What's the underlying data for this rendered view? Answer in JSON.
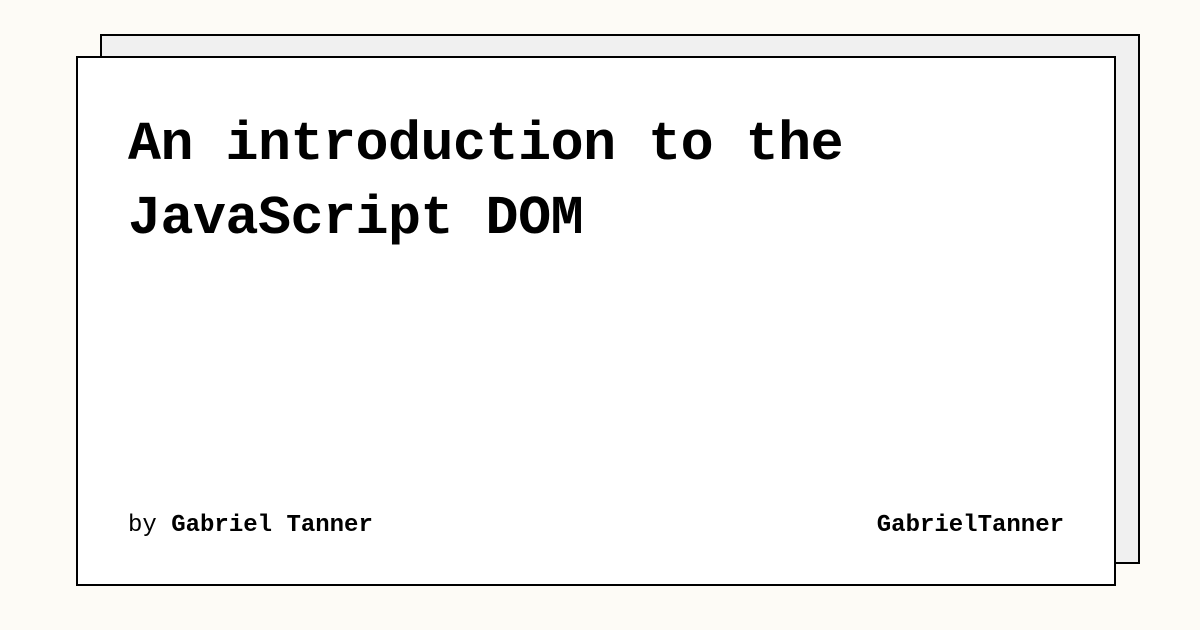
{
  "title": "An introduction to the JavaScript DOM",
  "byline": {
    "prefix": "by",
    "author": "Gabriel Tanner"
  },
  "site_name": "GabrielTanner"
}
